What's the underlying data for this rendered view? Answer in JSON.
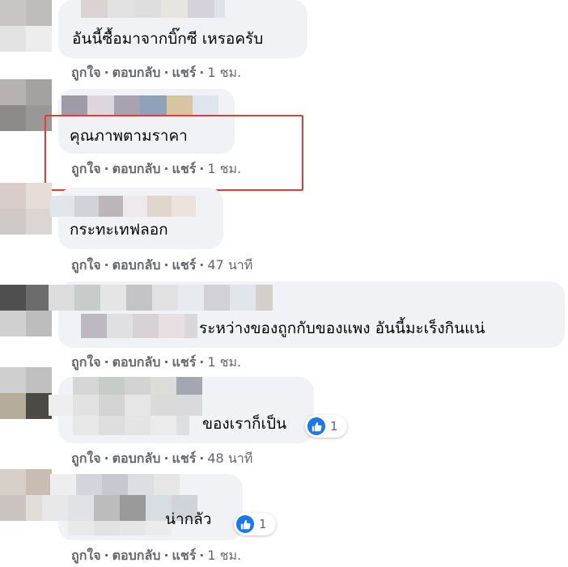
{
  "actions": {
    "like_label": "ถูกใจ",
    "reply_label": "ตอบกลับ",
    "share_label": "แชร์",
    "separator": "·"
  },
  "comments": [
    {
      "text": "อันนี้ซื้อมาจากบิ๊กซี เหรอครับ",
      "time": "1 ชม."
    },
    {
      "text": "คุณภาพตามราคา",
      "time": "1 ชม.",
      "highlighted": true
    },
    {
      "text": "กระทะเทฟลอก",
      "time": "47 นาที"
    },
    {
      "text": "ระหว่างของถูกกับของแพง อันนี้มะเร็งกินแน่",
      "time": "1 ชม."
    },
    {
      "text": "ของเราก็เป็น",
      "time": "48 นาที",
      "reactions": {
        "icon": "thumbs-up-icon",
        "count": "1"
      }
    },
    {
      "text": "น่ากลัว",
      "time": "1 ชม.",
      "reactions": {
        "icon": "thumbs-up-icon",
        "count": "1"
      }
    }
  ],
  "colors": {
    "bubble": "#f0f2f5",
    "meta_text": "#65676b",
    "like_blue": "#1877f2",
    "highlight_red": "#e53935"
  }
}
